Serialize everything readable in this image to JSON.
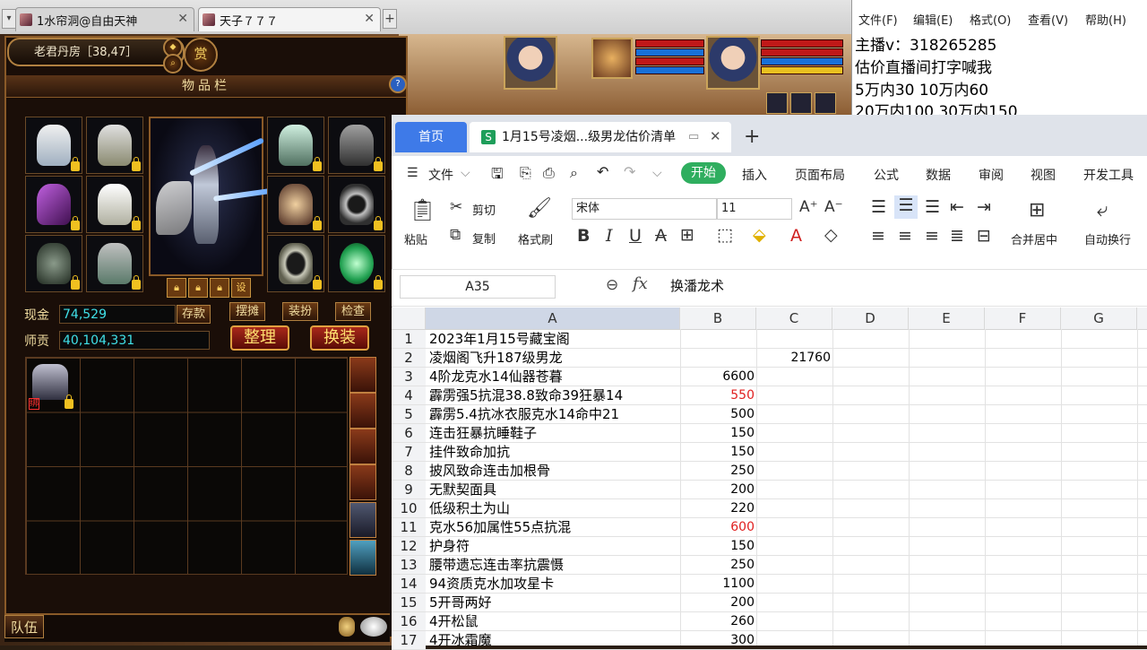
{
  "browser": {
    "tabs": [
      {
        "title": "1水帘洞@自由天神"
      },
      {
        "title": "天子７７７"
      }
    ],
    "new_tab": "+"
  },
  "game": {
    "location": "老君丹房［38,47］",
    "inventory_title": "物品栏",
    "reward_icon_text": "赏",
    "cash_label": "现金",
    "cash_value": "74,529",
    "mentor_label": "师贡",
    "mentor_value": "40,104,331",
    "buttons": {
      "deposit": "存款",
      "stall": "摆摊",
      "dress": "装扮",
      "inspect": "检查",
      "organize": "整理",
      "change_equip": "换装"
    },
    "char_button_set": "设",
    "team_label": "队伍",
    "bag_item_badge": "绑"
  },
  "notepad": {
    "menu": [
      "文件(F)",
      "编辑(E)",
      "格式(O)",
      "查看(V)",
      "帮助(H)"
    ],
    "lines": [
      "主播v：318265285",
      "估价直播间打字喊我",
      "5万内30 10万内60",
      "20万内100 30万内150"
    ]
  },
  "spreadsheet": {
    "home_tab": "首页",
    "doc_icon": "S",
    "doc_title": "1月15号凌烟...级男龙估价清单",
    "add_tab": "+",
    "menu": [
      "文件",
      "开始",
      "插入",
      "页面布局",
      "公式",
      "数据",
      "审阅",
      "视图",
      "开发工具"
    ],
    "toolbar": {
      "paste": "粘贴",
      "cut": "剪切",
      "copy": "复制",
      "format_painter": "格式刷",
      "font_name": "宋体",
      "font_size": "11",
      "merge_center": "合并居中",
      "wrap_text": "自动换行"
    },
    "name_box": "A35",
    "fx": "fx",
    "formula": "换潘龙术",
    "columns": [
      "A",
      "B",
      "C",
      "D",
      "E",
      "F",
      "G"
    ],
    "rows": [
      {
        "n": "1",
        "a": "2023年1月15号藏宝阁",
        "b": "",
        "c": ""
      },
      {
        "n": "2",
        "a": "凌烟阁飞升187级男龙",
        "b": "",
        "c": "21760"
      },
      {
        "n": "3",
        "a": "4阶龙克水14仙器苍暮",
        "b": "6600",
        "c": ""
      },
      {
        "n": "4",
        "a": "霹雳强5抗混38.8致命39狂暴14",
        "b": "550",
        "c": "",
        "red": true
      },
      {
        "n": "5",
        "a": "霹雳5.4抗冰衣服克水14命中21",
        "b": "500",
        "c": ""
      },
      {
        "n": "6",
        "a": "连击狂暴抗睡鞋子",
        "b": "150",
        "c": ""
      },
      {
        "n": "7",
        "a": "挂件致命加抗",
        "b": "150",
        "c": ""
      },
      {
        "n": "8",
        "a": "披风致命连击加根骨",
        "b": "250",
        "c": ""
      },
      {
        "n": "9",
        "a": "无默契面具",
        "b": "200",
        "c": ""
      },
      {
        "n": "10",
        "a": "低级积土为山",
        "b": "220",
        "c": ""
      },
      {
        "n": "11",
        "a": "克水56加属性55点抗混",
        "b": "600",
        "c": "",
        "red": true
      },
      {
        "n": "12",
        "a": "护身符",
        "b": "150",
        "c": ""
      },
      {
        "n": "13",
        "a": "腰带遗忘连击率抗震慑",
        "b": "250",
        "c": ""
      },
      {
        "n": "14",
        "a": "94资质克水加攻星卡",
        "b": "1100",
        "c": ""
      },
      {
        "n": "15",
        "a": "5开哥两好",
        "b": "200",
        "c": ""
      },
      {
        "n": "16",
        "a": "4开松鼠",
        "b": "260",
        "c": ""
      },
      {
        "n": "17",
        "a": "4开冰霜魔",
        "b": "300",
        "c": ""
      }
    ]
  }
}
